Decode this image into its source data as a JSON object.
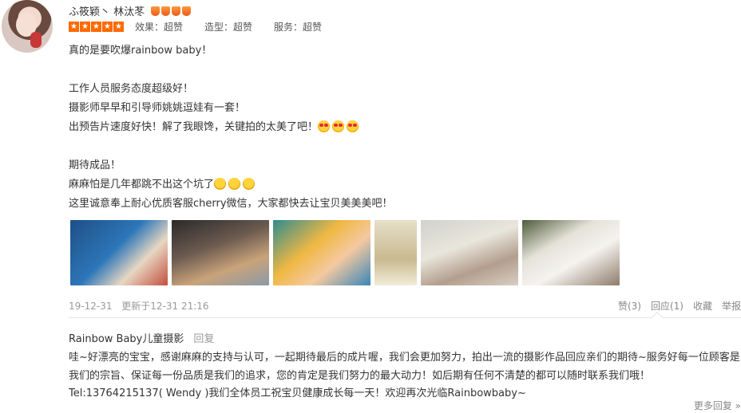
{
  "review": {
    "username": "ふ筱颖丶 林汰苳",
    "crown_count": 4,
    "stars": 5,
    "scores": [
      {
        "label": "效果：超赞"
      },
      {
        "label": "造型：超赞"
      },
      {
        "label": "服务：超赞"
      }
    ],
    "lines": [
      "真的是要吹爆rainbow baby！",
      "",
      "工作人员服务态度超级好！",
      "摄影师早早和引导师姚姚逗娃有一套！",
      "出预告片速度好快！解了我眼馋，关键拍的太美了吧！",
      "",
      "期待成品！",
      "麻麻怕是几年都跳不出这个坑了",
      "这里诚意奉上耐心优质客服cherry微信，大家都快去让宝贝美美美吧！"
    ],
    "photo_count": 6,
    "date": "19-12-31",
    "updated": "更新于12-31 21:16",
    "actions": {
      "like": "赞(3)",
      "reply": "回应(1)",
      "favorite": "收藏",
      "report": "举报"
    }
  },
  "reply": {
    "author": "Rainbow Baby儿童摄影",
    "reply_link": "回复",
    "body": "哇~好漂亮的宝宝，感谢麻麻的支持与认可，一起期待最后的成片喔，我们会更加努力，拍出一流的摄影作品回应亲们的期待~服务好每一位顾客是我们的宗旨、保证每一份品质是我们的追求，您的肯定是我们努力的最大动力！如后期有任何不清楚的都可以随时联系我们哦！Tel:13764215137( Wendy )我们全体员工祝宝贝健康成长每一天！欢迎再次光临Rainbowbaby~",
    "more": "更多回复 »"
  },
  "colors": {
    "star": "#ff6a00",
    "crown": "#e95b1c",
    "meta": "#999999",
    "text": "#333333"
  }
}
